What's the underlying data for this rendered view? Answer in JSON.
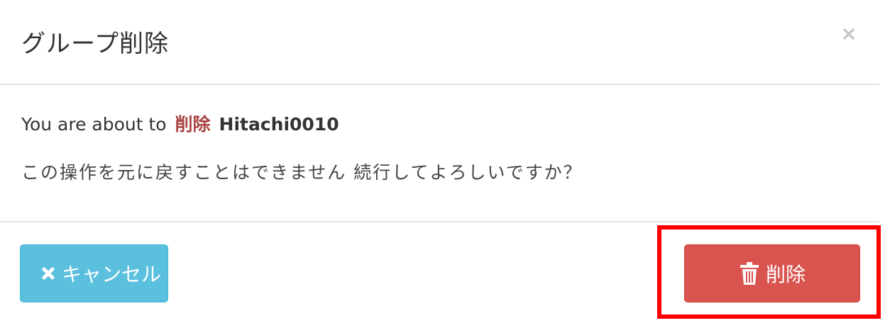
{
  "dialog": {
    "title": "グループ削除",
    "close_label": "×"
  },
  "body": {
    "prefix": "You are about to",
    "action_word": "削除",
    "target_name": "Hitachi0010",
    "warning": "この操作を元に戻すことはできません 続行してよろしいですか？"
  },
  "footer": {
    "cancel_label": "キャンセル",
    "cancel_icon": "times-icon",
    "delete_label": "削除",
    "delete_icon": "trash-icon"
  },
  "colors": {
    "cancel_button": "#5bc0de",
    "delete_button": "#d9534f",
    "action_word": "#a94442",
    "highlight": "#ff0000"
  }
}
